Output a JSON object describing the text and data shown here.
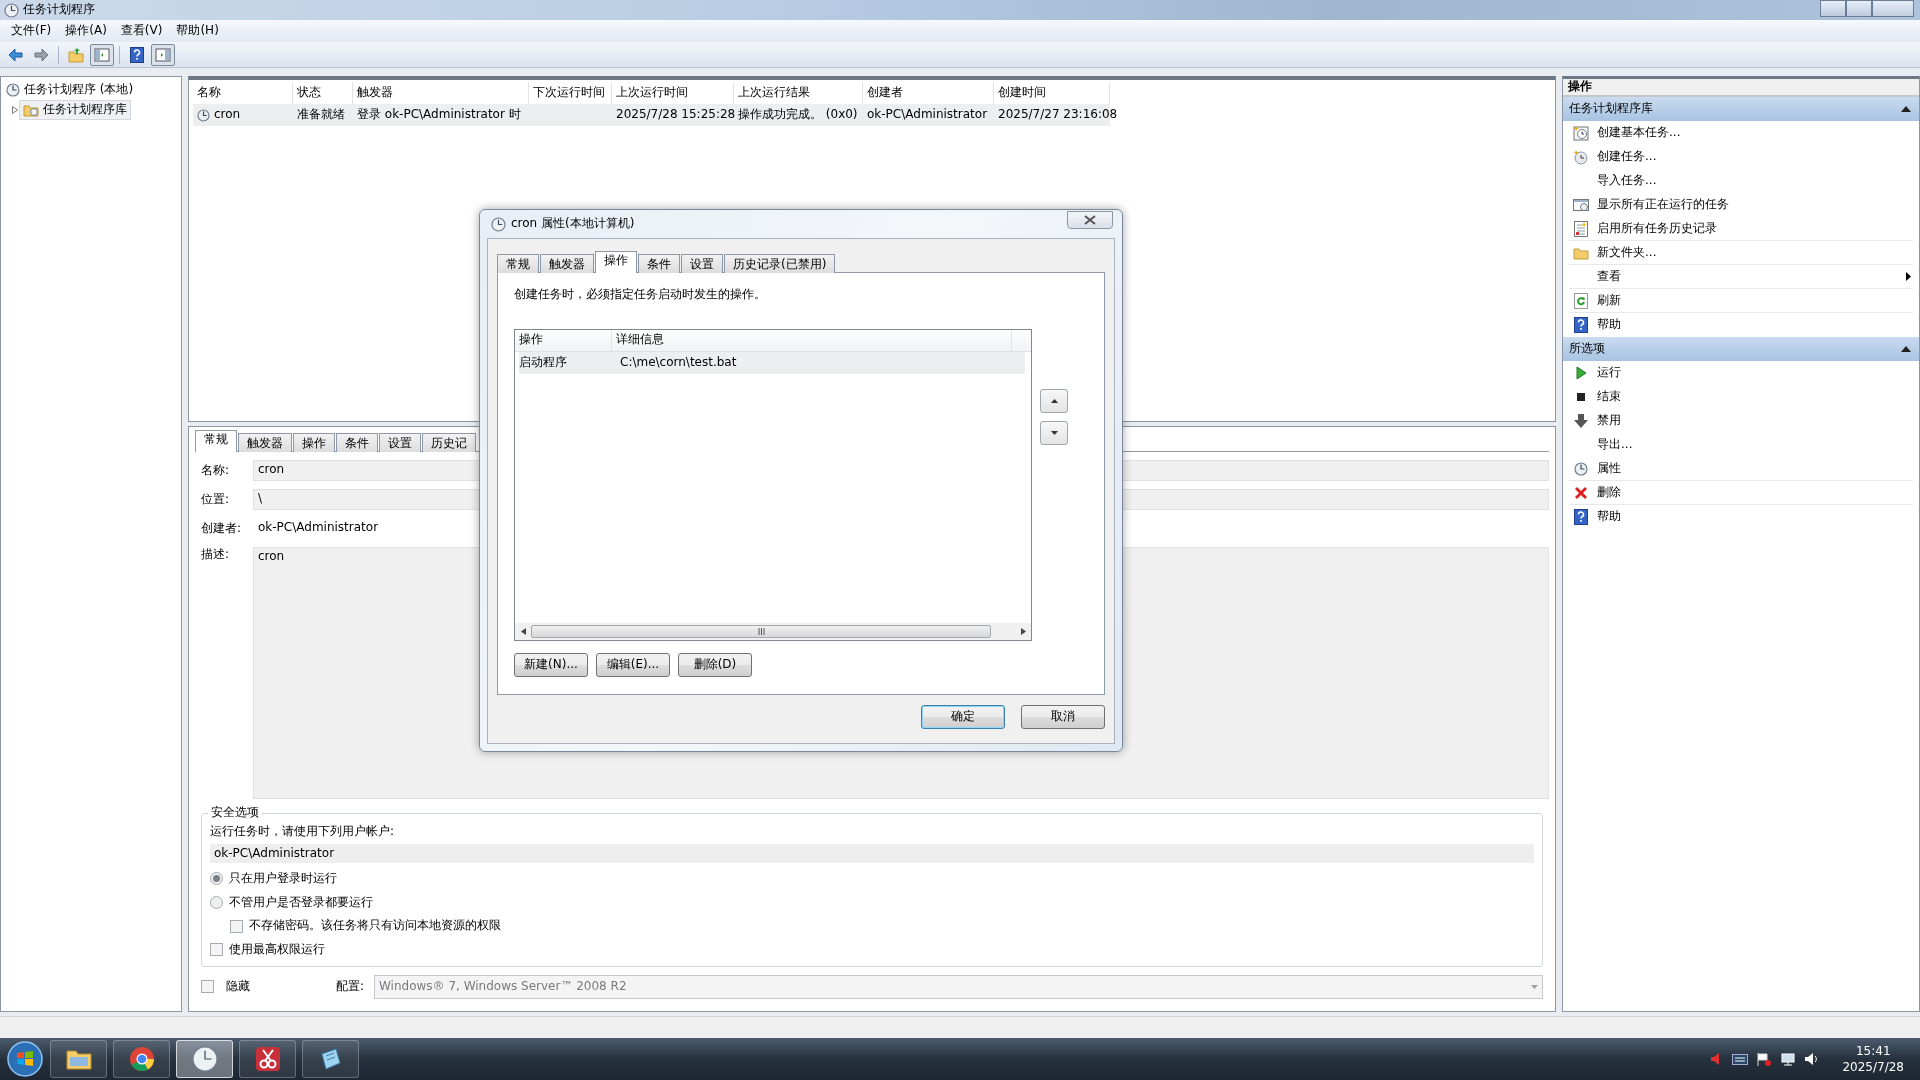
{
  "window": {
    "title": "任务计划程序"
  },
  "menu": [
    "文件(F)",
    "操作(A)",
    "查看(V)",
    "帮助(H)"
  ],
  "toolbar": [
    {
      "pressed": false
    },
    {
      "pressed": false
    },
    {
      "pressed": false
    },
    {
      "pressed": true
    },
    {
      "pressed": false
    },
    {
      "pressed": true
    }
  ],
  "tree": [
    {
      "label": "任务计划程序 (本地)",
      "selected": false,
      "children": [
        {
          "label": "任务计划程序库",
          "selected": true,
          "expanded": false
        }
      ]
    }
  ],
  "task_table": {
    "columns": [
      "名称",
      "状态",
      "触发器",
      "下次运行时间",
      "上次运行时间",
      "上次运行结果",
      "创建者",
      "创建时间"
    ],
    "rows": [
      {
        "selected": true,
        "cells": [
          "cron",
          "准备就绪",
          "登录 ok-PC\\Administrator 时",
          "",
          "2025/7/28 15:25:28",
          "操作成功完成。 (0x0)",
          "ok-PC\\Administrator",
          "2025/7/27 23:16:08"
        ]
      }
    ]
  },
  "details": {
    "tabs": [
      {
        "label": "常规",
        "selected": true
      },
      {
        "label": "触发器",
        "selected": false
      },
      {
        "label": "操作",
        "selected": false
      },
      {
        "label": "条件",
        "selected": false
      },
      {
        "label": "设置",
        "selected": false
      },
      {
        "label": "历史记",
        "selected": false
      }
    ],
    "fields": [
      {
        "kind": "field",
        "label": "名称:",
        "value": "cron"
      },
      {
        "kind": "field",
        "label": "位置:",
        "value": "\\"
      },
      {
        "kind": "plain",
        "label": "创建者:",
        "value": "ok-PC\\Administrator"
      },
      {
        "kind": "area",
        "label": "描述:",
        "value": "cron"
      }
    ],
    "security": {
      "title": "安全选项",
      "prompt": "运行任务时，请使用下列用户帐户:",
      "account": "ok-PC\\Administrator",
      "options": [
        {
          "kind": "radio",
          "label": "只在用户登录时运行",
          "selected": true
        },
        {
          "kind": "radio",
          "label": "不管用户是否登录都要运行",
          "selected": false,
          "children": [
            {
              "kind": "checkbox",
              "label": "不存储密码。该任务将只有访问本地资源的权限",
              "checked": false
            }
          ]
        },
        {
          "kind": "checkbox",
          "label": "使用最高权限运行",
          "checked": false
        }
      ]
    },
    "hidden": {
      "label": "隐藏",
      "checked": false
    },
    "config": {
      "label": "配置:",
      "value": "Windows® 7, Windows Server™ 2008 R2",
      "disabled": true
    }
  },
  "dialog": {
    "title": "cron 属性(本地计算机)",
    "tabs": [
      {
        "label": "常规",
        "selected": false
      },
      {
        "label": "触发器",
        "selected": false
      },
      {
        "label": "操作",
        "selected": true
      },
      {
        "label": "条件",
        "selected": false
      },
      {
        "label": "设置",
        "selected": false
      },
      {
        "label": "历史记录(已禁用)",
        "selected": false
      }
    ],
    "instruction": "创建任务时，必须指定任务启动时发生的操作。",
    "columns": [
      "操作",
      "详细信息"
    ],
    "rows": [
      {
        "selected": true,
        "cells": [
          "启动程序",
          "C:\\me\\corn\\test.bat"
        ]
      }
    ],
    "buttons": [
      "新建(N)...",
      "编辑(E)...",
      "删除(D)"
    ],
    "footer_buttons": [
      {
        "label": "确定",
        "default": true
      },
      {
        "label": "取消",
        "default": false
      }
    ]
  },
  "actions": {
    "title": "操作",
    "sections": [
      {
        "title": "任务计划程序库",
        "expanded": true,
        "items": [
          {
            "label": "创建基本任务..."
          },
          {
            "label": "创建任务..."
          },
          {
            "label": "导入任务..."
          },
          {
            "label": "显示所有正在运行的任务"
          },
          {
            "label": "启用所有任务历史记录"
          },
          {
            "label": "新文件夹..."
          },
          {
            "label": "查看",
            "submenu": true
          },
          {
            "label": "刷新"
          },
          {
            "label": "帮助"
          }
        ]
      },
      {
        "title": "所选项",
        "expanded": true,
        "items": [
          {
            "label": "运行"
          },
          {
            "label": "结束"
          },
          {
            "label": "禁用"
          },
          {
            "label": "导出..."
          },
          {
            "label": "属性"
          },
          {
            "label": "删除"
          },
          {
            "label": "帮助"
          }
        ]
      }
    ]
  },
  "taskbar": {
    "apps": [
      {
        "active": false
      },
      {
        "active": false
      },
      {
        "active": true
      },
      {
        "active": false
      },
      {
        "active": false
      }
    ]
  },
  "clock": {
    "time": "15:41",
    "date": "2025/7/28"
  }
}
